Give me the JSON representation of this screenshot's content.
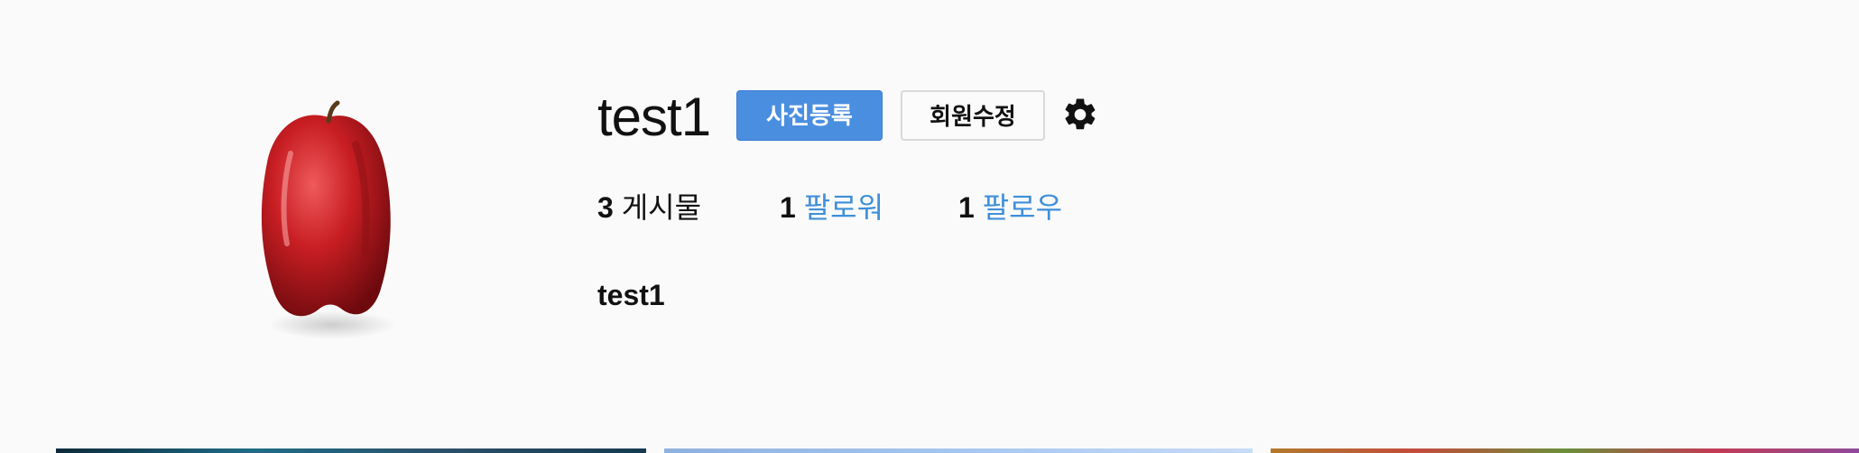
{
  "profile": {
    "username": "test1",
    "display_name": "test1",
    "avatar_icon": "apple-avatar"
  },
  "actions": {
    "upload_photo_label": "사진등록",
    "edit_profile_label": "회원수정",
    "settings_icon": "gear-icon"
  },
  "stats": {
    "posts": {
      "count": "3",
      "label": "게시물"
    },
    "followers": {
      "count": "1",
      "label": "팔로워"
    },
    "following": {
      "count": "1",
      "label": "팔로우"
    }
  },
  "colors": {
    "primary_button": "#4a8ee0",
    "link": "#3f8fd8",
    "background": "#fafafa"
  }
}
